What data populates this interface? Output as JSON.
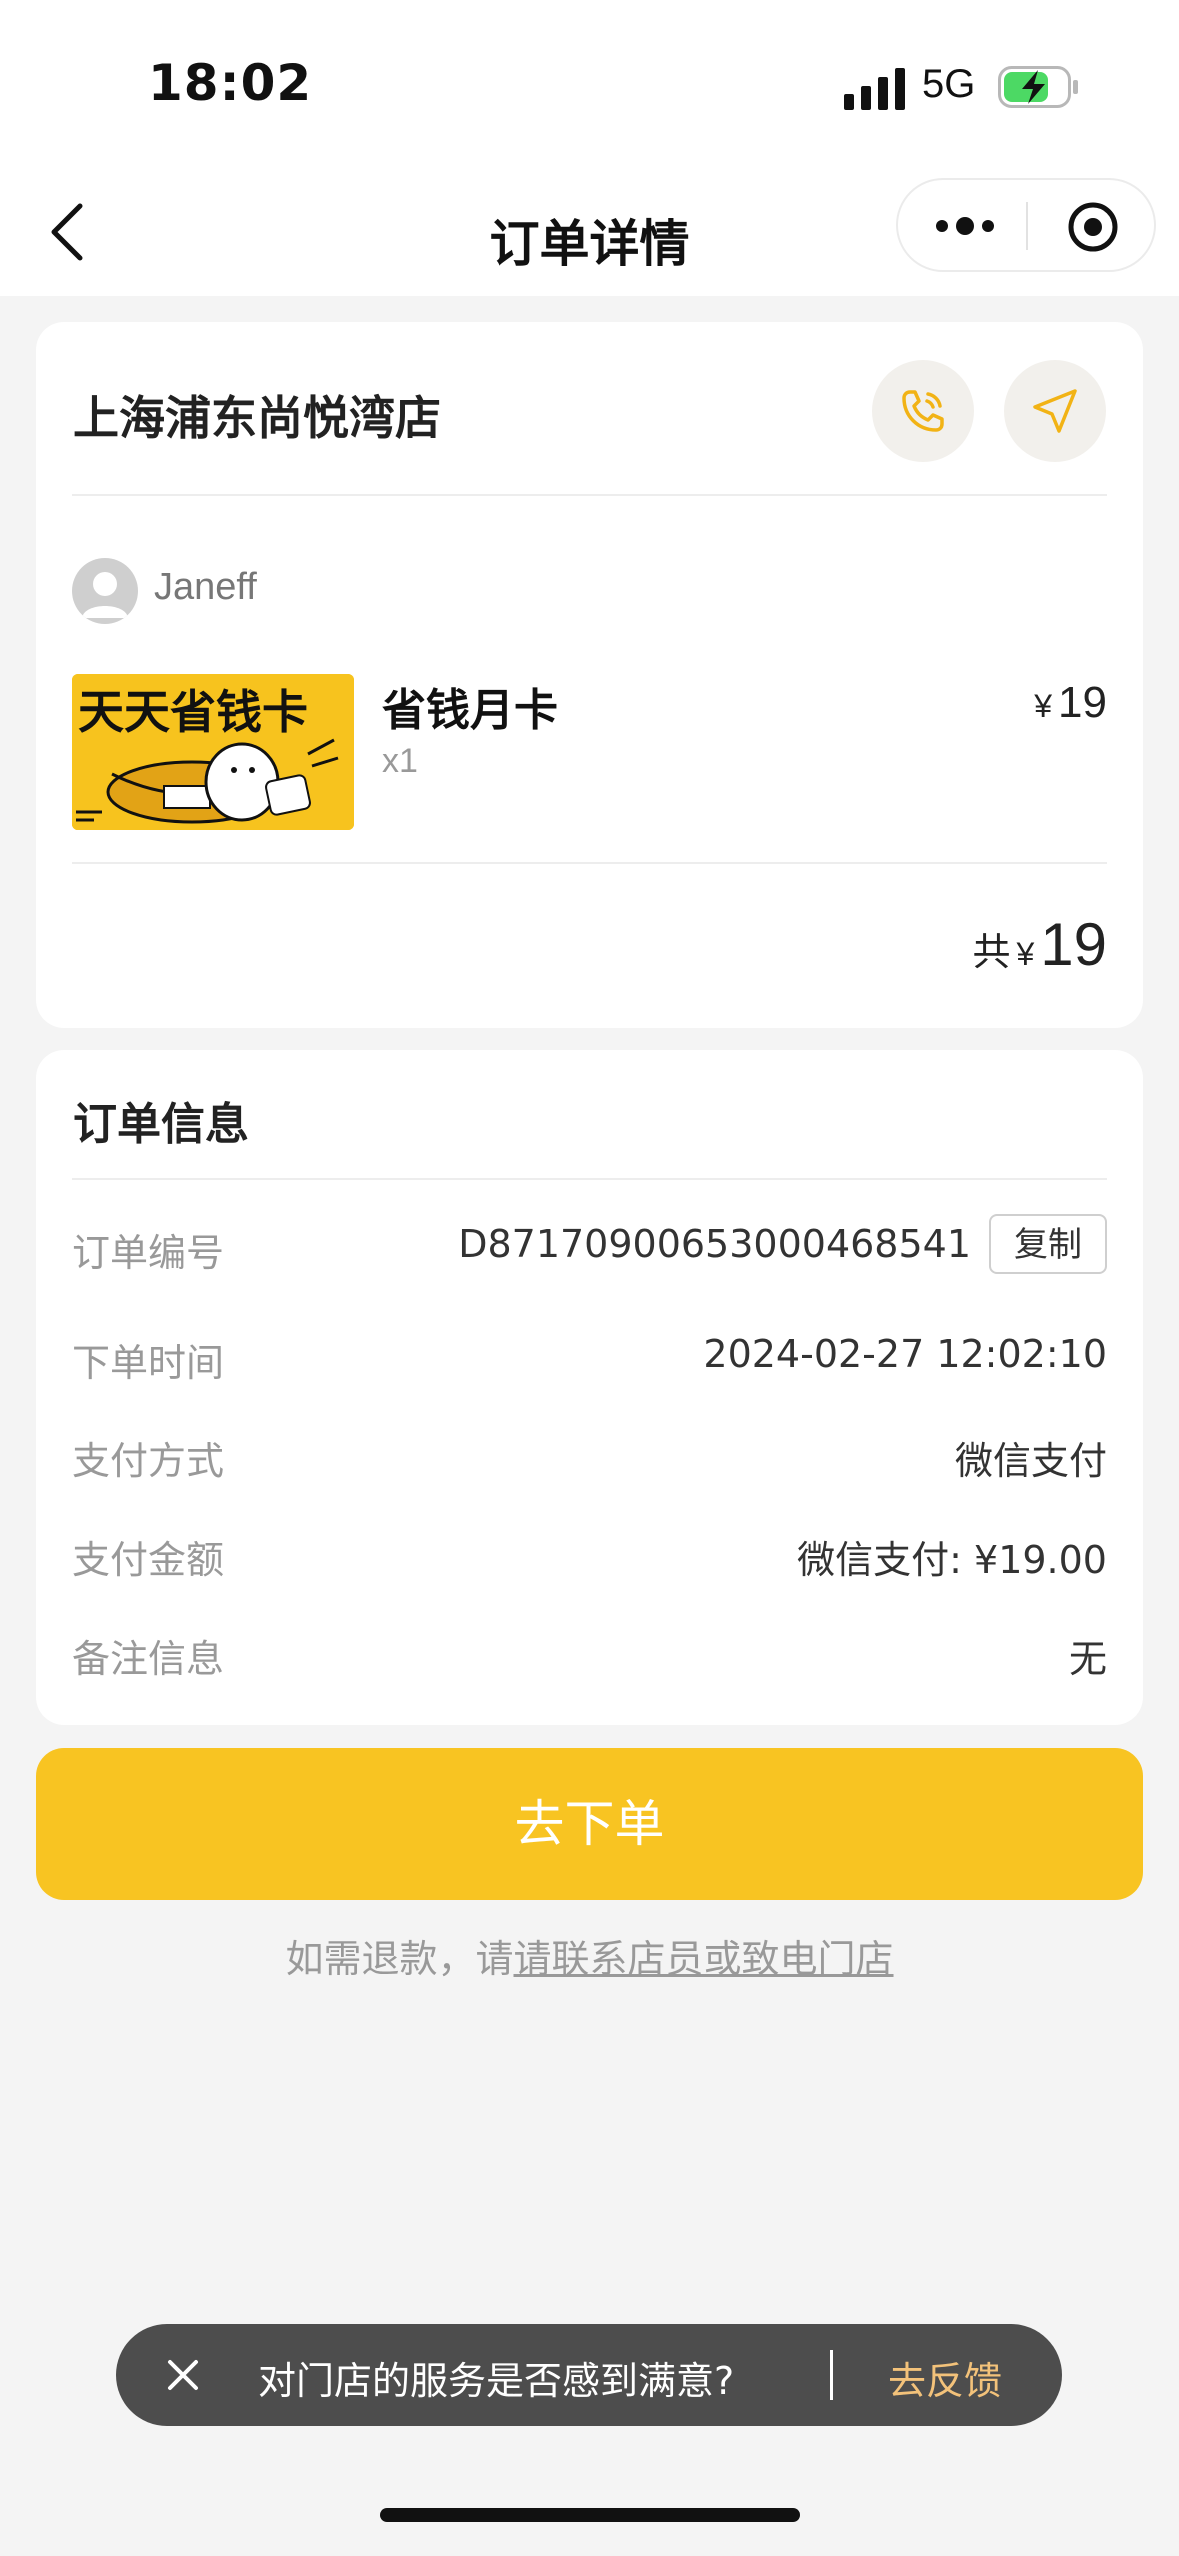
{
  "status_bar": {
    "time": "18:02",
    "network": "5G"
  },
  "nav": {
    "title": "订单详情"
  },
  "store": {
    "name": "上海浦东尚悦湾店",
    "user_name": "Janeff",
    "product": {
      "name": "省钱月卡",
      "qty": "x1",
      "currency": "¥",
      "price": "19",
      "image_text": "天天省钱卡"
    },
    "total_label": "共",
    "total_currency": "¥",
    "total_value": "19"
  },
  "order_info": {
    "title": "订单信息",
    "copy_label": "复制",
    "rows": [
      {
        "label": "订单编号",
        "value": "D87170900653000468541"
      },
      {
        "label": "下单时间",
        "value": "2024-02-27 12:02:10"
      },
      {
        "label": "支付方式",
        "value": "微信支付"
      },
      {
        "label": "支付金额",
        "value": "微信支付: ¥19.00"
      },
      {
        "label": "备注信息",
        "value": "无"
      }
    ]
  },
  "order_button": "去下单",
  "refund": {
    "prefix": "如需退款，请",
    "link": "请联系店员或致电门店"
  },
  "feedback": {
    "text": "对门店的服务是否感到满意?",
    "link": "去反馈"
  },
  "colors": {
    "accent": "#f8c422",
    "icon_accent": "#f2b315",
    "feedback_link": "#f3c27a"
  }
}
